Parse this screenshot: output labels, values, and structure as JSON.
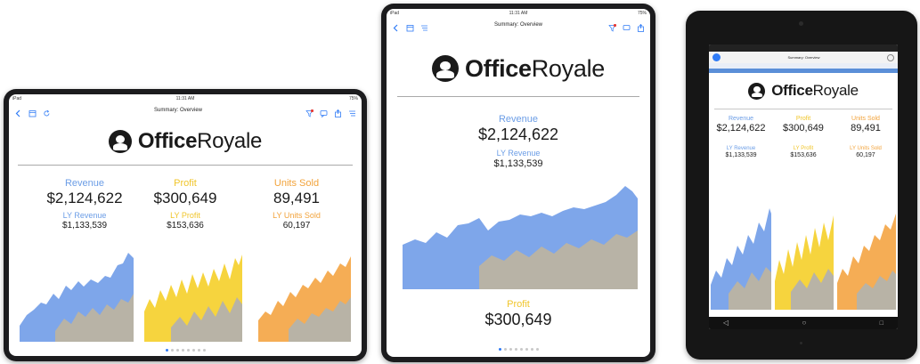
{
  "ios": {
    "time": "11:31 AM",
    "battery": "75%",
    "carrier": "iPad",
    "nav_title": "Summary: Overview"
  },
  "brand": {
    "name_bold": "Office",
    "name_rest": "Royale"
  },
  "metrics": {
    "revenue_label": "Revenue",
    "revenue_value": "$2,124,622",
    "ly_revenue_label": "LY Revenue",
    "ly_revenue_value": "$1,133,539",
    "profit_label": "Profit",
    "profit_value": "$300,649",
    "ly_profit_label": "LY Profit",
    "ly_profit_value": "$153,636",
    "units_label": "Units Sold",
    "units_value": "89,491",
    "ly_units_label": "LY Units Sold",
    "ly_units_value": "60,197"
  },
  "colors": {
    "revenue_fill": "#7ea6ea",
    "profit_fill": "#f6d43e",
    "units_fill": "#f5ad55",
    "ly_fill": "#b8b3a6",
    "accent": "#2f7bf6"
  },
  "icons": [
    "back-icon",
    "calendar-icon",
    "refresh-icon",
    "filter-icon",
    "comment-icon",
    "share-icon",
    "menu-icon",
    "logo-icon"
  ]
}
